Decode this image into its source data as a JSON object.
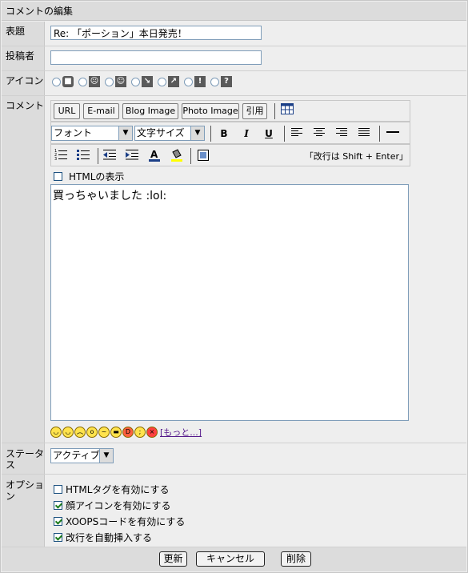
{
  "title": "コメントの編集",
  "fields": {
    "subject_label": "表題",
    "subject_value": "Re: 「ポーション」本日発売！",
    "poster_label": "投稿者",
    "poster_value": "",
    "icon_label": "アイコン",
    "icons": [
      "stop",
      "frown",
      "smile",
      "down-right-arrow",
      "up-right-arrow",
      "exclamation",
      "question"
    ],
    "comment_label": "コメント",
    "status_label": "ステータス",
    "status_value": "アクティブ",
    "options_label": "オプション"
  },
  "editor": {
    "buttons": [
      "URL",
      "E-mail",
      "Blog Image",
      "Photo Image",
      "引用"
    ],
    "font_select": "フォント",
    "size_select": "文字サイズ",
    "format_icons": [
      "B",
      "I",
      "U"
    ],
    "hint": "「改行は Shift + Enter」",
    "show_html_label": "HTMLの表示",
    "content": "買っちゃいました :lol:",
    "more_link": "[もっと...]"
  },
  "options": [
    {
      "label": "HTMLタグを有効にする",
      "checked": false
    },
    {
      "label": "顔アイコンを有効にする",
      "checked": true
    },
    {
      "label": "XOOPSコードを有効にする",
      "checked": true
    },
    {
      "label": "改行を自動挿入する",
      "checked": true
    }
  ],
  "footer": {
    "update_label": "更新",
    "cancel_label": "キャンセル",
    "delete_label": "削除"
  },
  "colors": {
    "label_bg": "#dcdcdc",
    "value_bg": "#eeeeee",
    "link": "#551a8b"
  }
}
